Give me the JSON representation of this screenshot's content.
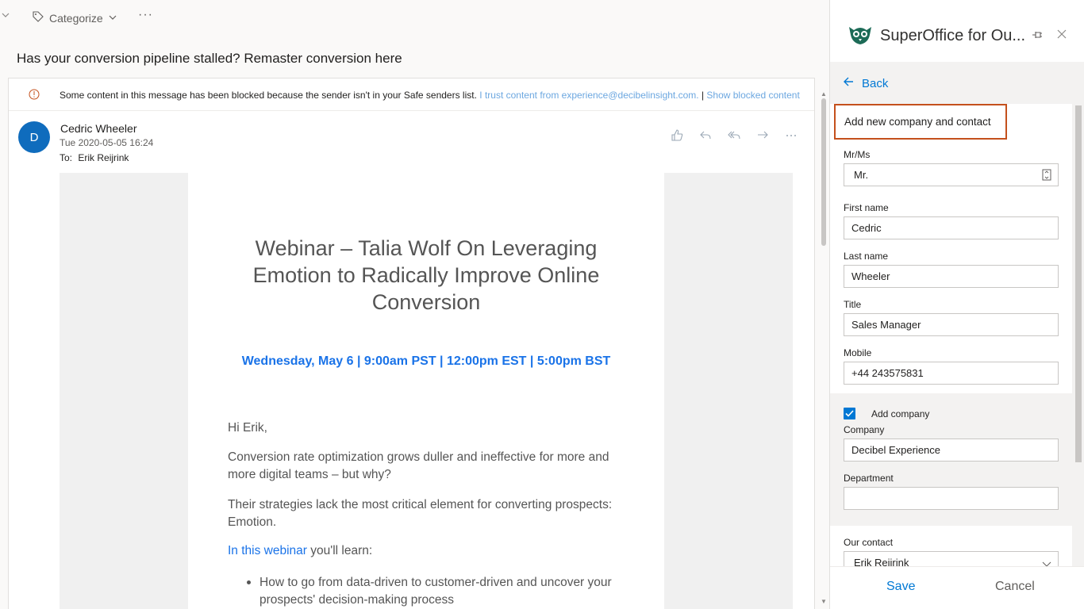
{
  "toolbar": {
    "categorize_label": "Categorize",
    "more_label": "···"
  },
  "mail": {
    "subject": "Has your conversion pipeline stalled? Remaster conversion here",
    "infobar": {
      "text": "Some content in this message has been blocked because the sender isn't in your Safe senders list.",
      "trust_link": "I trust content from experience@decibelinsight.com.",
      "separator": "|",
      "show_link": "Show blocked content"
    },
    "sender": {
      "initial": "D",
      "name": "Cedric Wheeler",
      "date": "Tue 2020-05-05 16:24",
      "to_label": "To:",
      "to_value": "Erik Reijrink"
    },
    "body": {
      "title": "Webinar – Talia Wolf On Leveraging Emotion to Radically Improve Online Conversion",
      "date_line": "Wednesday, May 6 | 9:00am PST | 12:00pm EST | 5:00pm BST",
      "greeting": "Hi Erik,",
      "para1": "Conversion rate optimization grows duller and ineffective for more and more digital teams – but why?",
      "para2": "Their strategies lack the most critical element for converting prospects: Emotion.",
      "learn_link": "In this webinar",
      "learn_rest": " you'll learn:",
      "bullet1": "How to go from data-driven to customer-driven and uncover your prospects' decision-making process"
    },
    "colors": {
      "avatar": "#0f6cbd",
      "link": "#1a73e8",
      "info_link": "#6ca7e0"
    }
  },
  "panel": {
    "title": "SuperOffice for Ou...",
    "back_label": "Back",
    "heading": "Add new company and contact",
    "fields": {
      "mrms_label": "Mr/Ms",
      "mrms_value": "Mr.",
      "first_label": "First name",
      "first_value": "Cedric",
      "last_label": "Last name",
      "last_value": "Wheeler",
      "title_label": "Title",
      "title_value": "Sales Manager",
      "mobile_label": "Mobile",
      "mobile_value": "+44 243575831",
      "add_company_label": "Add company",
      "add_company_checked": true,
      "company_label": "Company",
      "company_value": "Decibel Experience",
      "department_label": "Department",
      "department_value": "",
      "ourcontact_label": "Our contact",
      "ourcontact_value": "Erik Reijrink"
    },
    "save_label": "Save",
    "cancel_label": "Cancel",
    "colors": {
      "accent": "#0078d4",
      "heading_border": "#c4501c"
    }
  }
}
